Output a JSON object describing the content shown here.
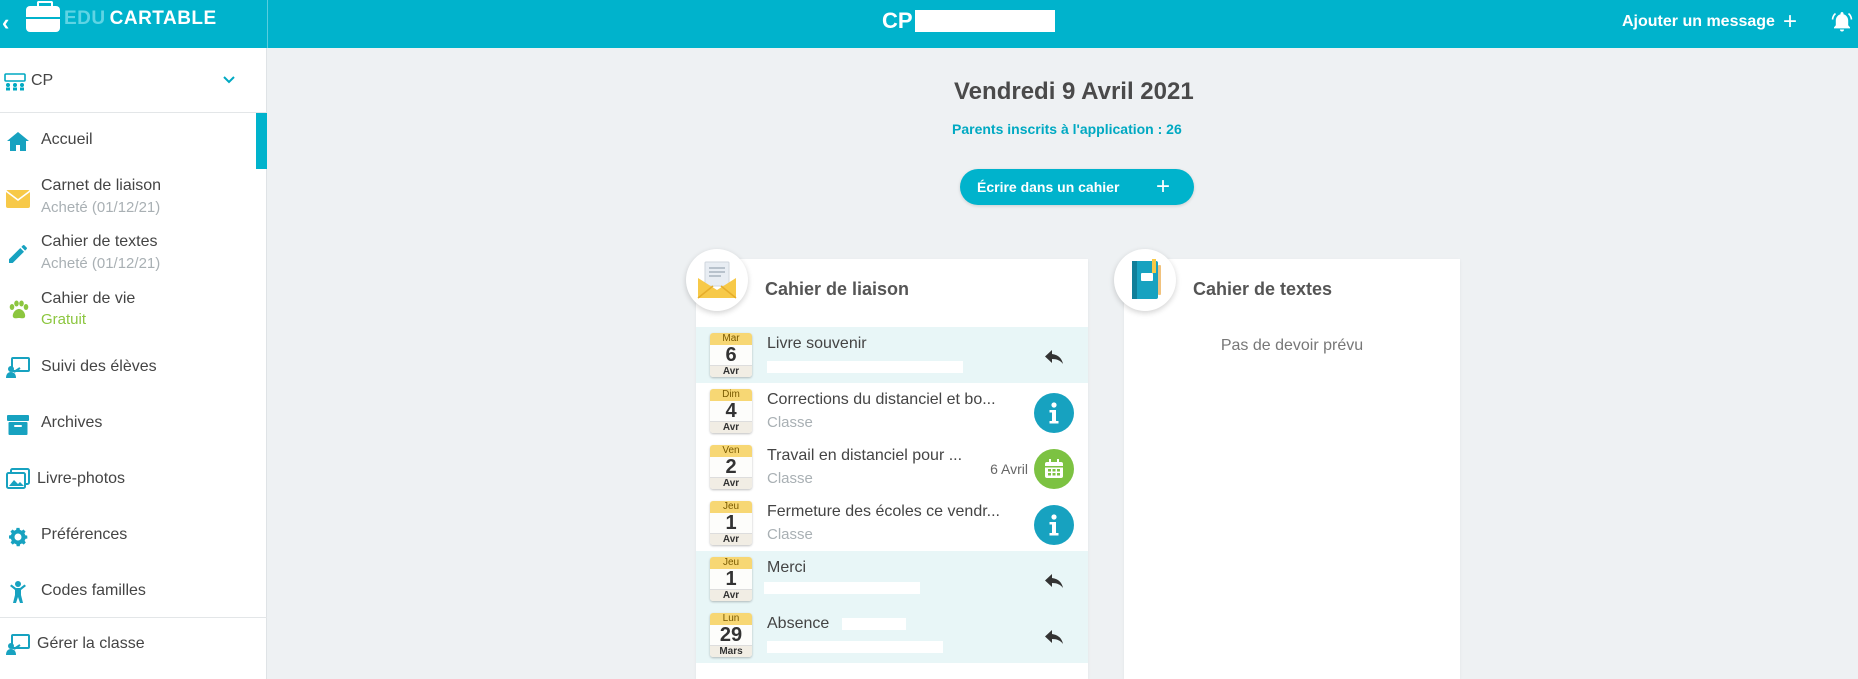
{
  "topbar": {
    "back_label": "‹",
    "logo_edu": "EDU",
    "logo_cartable": "CARTABLE",
    "class_name": "CP",
    "add_message_label": "Ajouter un message",
    "add_icon": "plus-icon",
    "bell_icon": "bell-icon"
  },
  "sidebar": {
    "class_select": {
      "value": "CP",
      "icon": "classroom-icon",
      "chevron": "⌄"
    },
    "items": [
      {
        "label": "Accueil",
        "icon": "home-icon",
        "sub": ""
      },
      {
        "label": "Carnet de liaison",
        "icon": "envelope-icon",
        "sub": "Acheté (01/12/21)"
      },
      {
        "label": "Cahier de textes",
        "icon": "pencil-icon",
        "sub": "Acheté (01/12/21)"
      },
      {
        "label": "Cahier de vie",
        "icon": "paw-icon",
        "sub": "Gratuit"
      },
      {
        "label": "Suivi des élèves",
        "icon": "teacher-board-icon",
        "sub": ""
      },
      {
        "label": "Archives",
        "icon": "archive-box-icon",
        "sub": ""
      },
      {
        "label": "Livre-photos",
        "icon": "photos-icon",
        "sub": ""
      },
      {
        "label": "Préférences",
        "icon": "gear-icon",
        "sub": ""
      },
      {
        "label": "Codes familles",
        "icon": "child-icon",
        "sub": ""
      },
      {
        "label": "Gérer la classe",
        "icon": "teacher-board-icon",
        "sub": ""
      }
    ]
  },
  "main": {
    "date_title": "Vendredi 9 Avril 2021",
    "parents_label": "Parents inscrits à l'application :",
    "parents_count": "26",
    "write_button_label": "Écrire dans un cahier",
    "write_button_icon": "plus-icon"
  },
  "liaison_card": {
    "title": "Cahier de liaison",
    "badge_icon": "envelope-letter-icon",
    "messages": [
      {
        "dow": "Mar",
        "day": "6",
        "month": "Avr",
        "title": "Livre souvenir",
        "sub": "",
        "action": "reply-icon",
        "highlight": true,
        "echeance": ""
      },
      {
        "dow": "Dim",
        "day": "4",
        "month": "Avr",
        "title": "Corrections du distanciel et bo...",
        "sub": "Classe",
        "action": "info-icon",
        "highlight": false,
        "echeance": ""
      },
      {
        "dow": "Ven",
        "day": "2",
        "month": "Avr",
        "title": "Travail en distanciel pour ...",
        "sub": "Classe",
        "action": "calendar-icon",
        "highlight": false,
        "echeance": "6 Avril"
      },
      {
        "dow": "Jeu",
        "day": "1",
        "month": "Avr",
        "title": "Fermeture des écoles ce vendr...",
        "sub": "Classe",
        "action": "info-icon",
        "highlight": false,
        "echeance": ""
      },
      {
        "dow": "Jeu",
        "day": "1",
        "month": "Avr",
        "title": "Merci",
        "sub": "",
        "action": "reply-icon",
        "highlight": true,
        "echeance": ""
      },
      {
        "dow": "Lun",
        "day": "29",
        "month": "Mars",
        "title": "Absence",
        "sub": "",
        "action": "reply-icon",
        "highlight": true,
        "echeance": ""
      }
    ]
  },
  "textes_card": {
    "title": "Cahier de textes",
    "badge_icon": "notebook-icon",
    "empty_text": "Pas de devoir prévu"
  },
  "colors": {
    "accent": "#00b3cc",
    "info": "#17a2c0",
    "calendar": "#7cc242",
    "highlight_row": "#e8f6f7",
    "free_green": "#8cc63f"
  }
}
